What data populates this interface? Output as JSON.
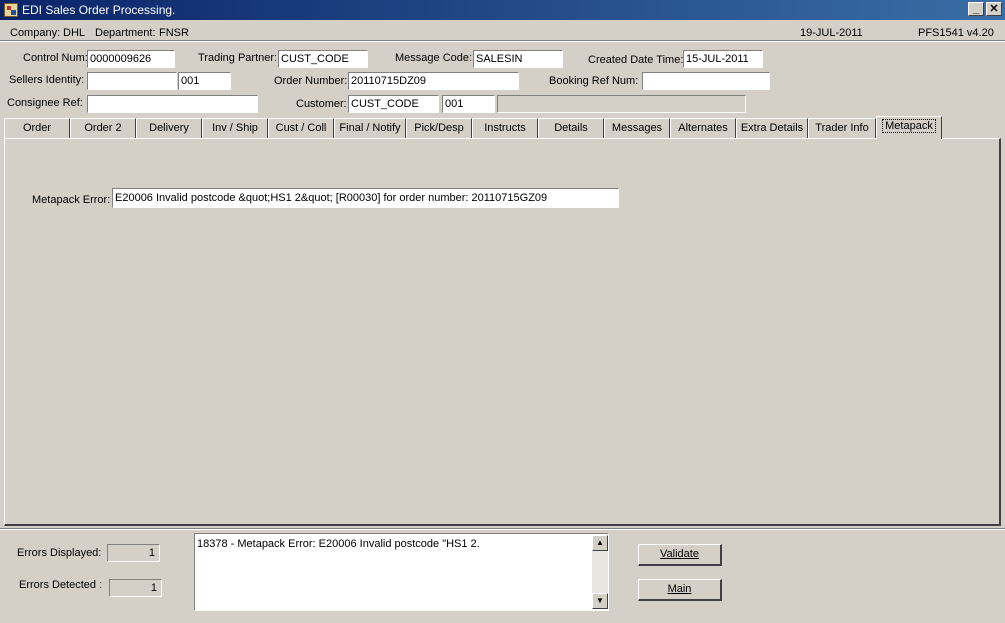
{
  "window": {
    "title": "EDI Sales Order Processing.",
    "minimize": "_",
    "close": "✕"
  },
  "infobar": {
    "company_label": "Company:",
    "company": "DHL",
    "department_label": "Department:",
    "department": "FNSR",
    "date": "19-JUL-2011",
    "program": "PFS1541  v4.20"
  },
  "header": {
    "control_num_label": "Control Num:",
    "control_num": "0000009626",
    "trading_partner_label": "Trading Partner:",
    "trading_partner": "CUST_CODE",
    "message_code_label": "Message Code:",
    "message_code": "SALESIN",
    "created_date_label": "Created Date Time:",
    "created_date": "15-JUL-2011",
    "sellers_identity_label": "Sellers Identity:",
    "sellers_identity": "",
    "sellers_identity_2": "001",
    "order_number_label": "Order Number:",
    "order_number": "20110715DZ09",
    "booking_ref_label": "Booking Ref Num:",
    "booking_ref": "",
    "consignee_ref_label": "Consignee Ref:",
    "consignee_ref": "",
    "customer_label": "Customer:",
    "customer": "CUST_CODE",
    "customer_2": "001",
    "customer_name": ""
  },
  "tabs": [
    {
      "label": "Order"
    },
    {
      "label": "Order 2"
    },
    {
      "label": "Delivery"
    },
    {
      "label": "Inv / Ship"
    },
    {
      "label": "Cust / Coll"
    },
    {
      "label": "Final / Notify"
    },
    {
      "label": "Pick/Desp"
    },
    {
      "label": "Instructs"
    },
    {
      "label": "Details"
    },
    {
      "label": "Messages"
    },
    {
      "label": "Alternates"
    },
    {
      "label": "Extra Details"
    },
    {
      "label": "Trader Info"
    },
    {
      "label": "Metapack"
    }
  ],
  "metapack": {
    "error_label": "Metapack Error:",
    "error_value": "E20006 Invalid postcode &quot;HS1 2&quot; [R00030] for order number: 20110715GZ09"
  },
  "footer": {
    "errors_displayed_label": "Errors Displayed:",
    "errors_displayed": "1",
    "errors_detected_label": "Errors Detected :",
    "errors_detected": "1",
    "message_text": "18378 - Metapack Error: E20006 Invalid postcode \"HS1 2.",
    "validate_label": "Validate",
    "main_label": "Main"
  }
}
